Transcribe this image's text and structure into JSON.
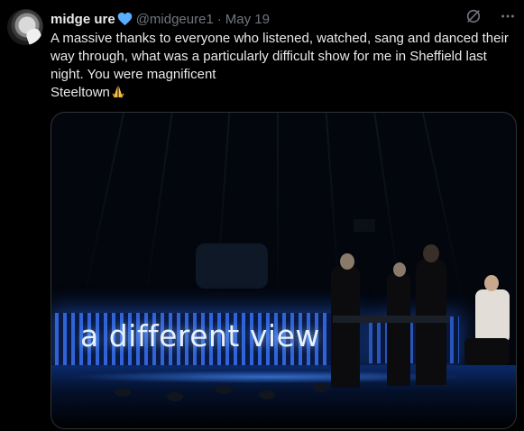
{
  "tweet": {
    "display_name": "midge ure",
    "handle": "@midgeure1",
    "separator": "·",
    "date": "May 19",
    "text_lines": [
      "A massive thanks to everyone who listened, watched, sang and danced their way through, what was a particularly difficult show for me in Sheffield last night. You were magnificent",
      "Steeltown"
    ],
    "verified_color": "#1d9bf0",
    "media": {
      "overlay_text": "a different view"
    }
  },
  "icons": {
    "verified": "blue-heart-icon",
    "grok": "grok-icon",
    "more": "more-icon",
    "pray": "folded-hands-icon"
  }
}
